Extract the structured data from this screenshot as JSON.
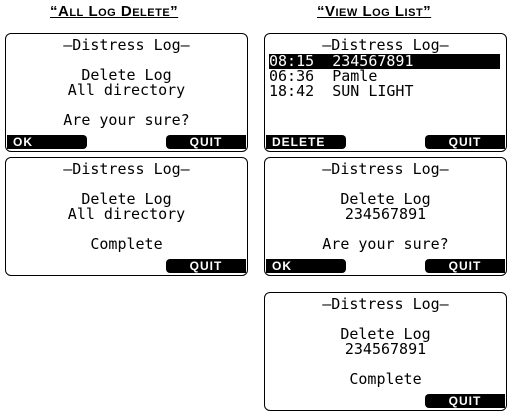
{
  "columns": {
    "left_title": "“All Log Delete”",
    "right_title": "“View Log List”"
  },
  "screens": {
    "left_confirm": {
      "header": "–Distress Log–",
      "line1": "Delete Log",
      "line2": "All directory",
      "prompt": "Are your sure?",
      "left_key": "OK",
      "right_key": "QUIT"
    },
    "left_complete": {
      "header": "–Distress Log–",
      "line1": "Delete Log",
      "line2": "All directory",
      "status": "Complete",
      "right_key": "QUIT"
    },
    "right_list": {
      "header": "–Distress Log–",
      "rows": [
        "08:15  234567891",
        "06:36  Pamle",
        "18:42  SUN LIGHT"
      ],
      "left_key": "DELETE",
      "right_key": "QUIT"
    },
    "right_confirm": {
      "header": "–Distress Log–",
      "line1": "Delete Log",
      "line2": "234567891",
      "prompt": "Are your sure?",
      "left_key": "OK",
      "right_key": "QUIT"
    },
    "right_complete": {
      "header": "–Distress Log–",
      "line1": "Delete Log",
      "line2": "234567891",
      "status": "Complete",
      "right_key": "QUIT"
    }
  }
}
